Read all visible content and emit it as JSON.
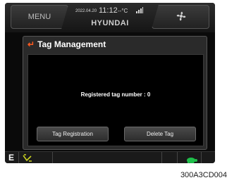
{
  "topbar": {
    "menu_label": "MENU",
    "date": "2022.04.20",
    "time": "11:12",
    "temp": "--°C",
    "brand": "HYUNDAI",
    "fan_icon": "fan-icon",
    "signal_icon": "signal-icon"
  },
  "dialog": {
    "title": "Tag Management",
    "title_icon": "return-arrow-icon",
    "count_text": "Registered tag number : 0",
    "buttons": {
      "register_label": "Tag Registration",
      "delete_label": "Delete Tag"
    }
  },
  "bottombar": {
    "mode": "E",
    "work_icon": "work-mode-icon",
    "speed_icon": "turtle-icon"
  },
  "caption": "300A3CD004",
  "colors": {
    "accent_orange": "#ff5a1f",
    "turtle_green": "#1fbf4a",
    "work_icon_yellow": "#c8d020"
  }
}
